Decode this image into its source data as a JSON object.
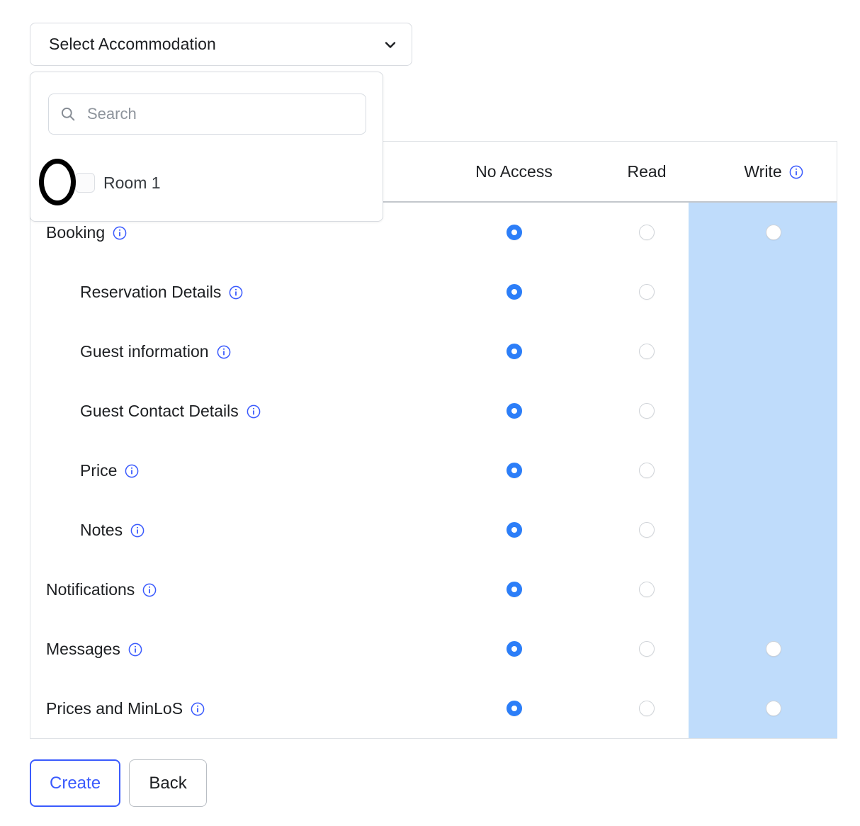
{
  "accommodation_select": {
    "label": "Select Accommodation",
    "chevron_icon": "chevron-down-icon",
    "expanded": true
  },
  "dropdown": {
    "search": {
      "placeholder": "Search",
      "value": "",
      "icon": "search-icon"
    },
    "options": [
      {
        "label": "Room 1",
        "checked": false,
        "annotated": true
      }
    ]
  },
  "permissions_table": {
    "columns": [
      {
        "key": "label",
        "label": ""
      },
      {
        "key": "no_access",
        "label": "No Access"
      },
      {
        "key": "read",
        "label": "Read"
      },
      {
        "key": "write",
        "label": "Write",
        "info": true,
        "highlighted": true
      }
    ],
    "rows": [
      {
        "label": "Booking",
        "indent": false,
        "info": true,
        "no_access": "selected",
        "read": "unselected",
        "write": "unselected"
      },
      {
        "label": "Reservation Details",
        "indent": true,
        "info": true,
        "no_access": "selected",
        "read": "unselected",
        "write": "none"
      },
      {
        "label": "Guest information",
        "indent": true,
        "info": true,
        "no_access": "selected",
        "read": "unselected",
        "write": "none"
      },
      {
        "label": "Guest Contact Details",
        "indent": true,
        "info": true,
        "no_access": "selected",
        "read": "unselected",
        "write": "none"
      },
      {
        "label": "Price",
        "indent": true,
        "info": true,
        "no_access": "selected",
        "read": "unselected",
        "write": "none"
      },
      {
        "label": "Notes",
        "indent": true,
        "info": true,
        "no_access": "selected",
        "read": "unselected",
        "write": "none"
      },
      {
        "label": "Notifications",
        "indent": false,
        "info": true,
        "no_access": "selected",
        "read": "unselected",
        "write": "none"
      },
      {
        "label": "Messages",
        "indent": false,
        "info": true,
        "no_access": "selected",
        "read": "unselected",
        "write": "unselected"
      },
      {
        "label": "Prices and MinLoS",
        "indent": false,
        "info": true,
        "no_access": "selected",
        "read": "unselected",
        "write": "unselected"
      }
    ]
  },
  "footer": {
    "create_label": "Create",
    "back_label": "Back"
  },
  "colors": {
    "accent_blue": "#2c7ef8",
    "info_blue": "#3b5bfd",
    "write_highlight": "#bfdcfb",
    "border_gray": "#dfe2e6",
    "text_dark": "#1d1f22",
    "annotation": "#000000"
  }
}
